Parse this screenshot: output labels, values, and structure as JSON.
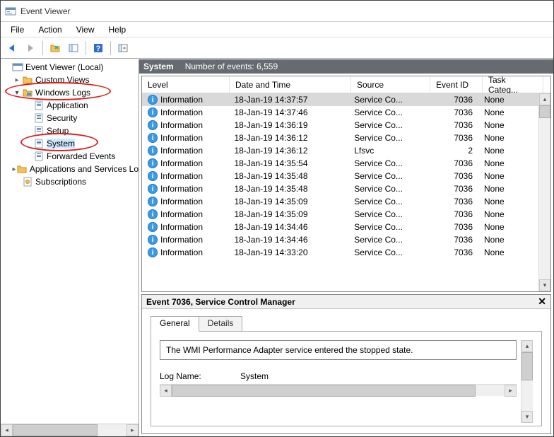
{
  "window": {
    "title": "Event Viewer"
  },
  "menubar": [
    "File",
    "Action",
    "View",
    "Help"
  ],
  "sidebar": {
    "root": "Event Viewer (Local)",
    "items": [
      {
        "label": "Custom Views",
        "caret": "closed",
        "indent": 1,
        "icon": "folder-tools"
      },
      {
        "label": "Windows Logs",
        "caret": "open",
        "indent": 1,
        "icon": "folder-win",
        "circled": true
      },
      {
        "label": "Application",
        "caret": "none",
        "indent": 2,
        "icon": "log"
      },
      {
        "label": "Security",
        "caret": "none",
        "indent": 2,
        "icon": "log"
      },
      {
        "label": "Setup",
        "caret": "none",
        "indent": 2,
        "icon": "log"
      },
      {
        "label": "System",
        "caret": "none",
        "indent": 2,
        "icon": "log",
        "circled": true,
        "selected": true
      },
      {
        "label": "Forwarded Events",
        "caret": "none",
        "indent": 2,
        "icon": "log"
      },
      {
        "label": "Applications and Services Lo",
        "caret": "closed",
        "indent": 1,
        "icon": "folder"
      },
      {
        "label": "Subscriptions",
        "caret": "none",
        "indent": 1,
        "icon": "subs"
      }
    ]
  },
  "category": {
    "title": "System",
    "count_label": "Number of events: 6,559"
  },
  "columns": [
    "Level",
    "Date and Time",
    "Source",
    "Event ID",
    "Task Categ..."
  ],
  "events": [
    {
      "level": "Information",
      "dt": "18-Jan-19 14:37:57",
      "source": "Service Co...",
      "eid": "7036",
      "task": "None",
      "selected": true
    },
    {
      "level": "Information",
      "dt": "18-Jan-19 14:37:46",
      "source": "Service Co...",
      "eid": "7036",
      "task": "None"
    },
    {
      "level": "Information",
      "dt": "18-Jan-19 14:36:19",
      "source": "Service Co...",
      "eid": "7036",
      "task": "None"
    },
    {
      "level": "Information",
      "dt": "18-Jan-19 14:36:12",
      "source": "Service Co...",
      "eid": "7036",
      "task": "None"
    },
    {
      "level": "Information",
      "dt": "18-Jan-19 14:36:12",
      "source": "Lfsvc",
      "eid": "2",
      "task": "None"
    },
    {
      "level": "Information",
      "dt": "18-Jan-19 14:35:54",
      "source": "Service Co...",
      "eid": "7036",
      "task": "None"
    },
    {
      "level": "Information",
      "dt": "18-Jan-19 14:35:48",
      "source": "Service Co...",
      "eid": "7036",
      "task": "None"
    },
    {
      "level": "Information",
      "dt": "18-Jan-19 14:35:48",
      "source": "Service Co...",
      "eid": "7036",
      "task": "None"
    },
    {
      "level": "Information",
      "dt": "18-Jan-19 14:35:09",
      "source": "Service Co...",
      "eid": "7036",
      "task": "None"
    },
    {
      "level": "Information",
      "dt": "18-Jan-19 14:35:09",
      "source": "Service Co...",
      "eid": "7036",
      "task": "None"
    },
    {
      "level": "Information",
      "dt": "18-Jan-19 14:34:46",
      "source": "Service Co...",
      "eid": "7036",
      "task": "None"
    },
    {
      "level": "Information",
      "dt": "18-Jan-19 14:34:46",
      "source": "Service Co...",
      "eid": "7036",
      "task": "None"
    },
    {
      "level": "Information",
      "dt": "18-Jan-19 14:33:20",
      "source": "Service Co...",
      "eid": "7036",
      "task": "None"
    }
  ],
  "detail": {
    "title": "Event 7036, Service Control Manager",
    "tabs": {
      "general": "General",
      "details": "Details"
    },
    "description": "The WMI Performance Adapter service entered the stopped state.",
    "kv": {
      "log_name_k": "Log Name:",
      "log_name_v": "System"
    }
  }
}
